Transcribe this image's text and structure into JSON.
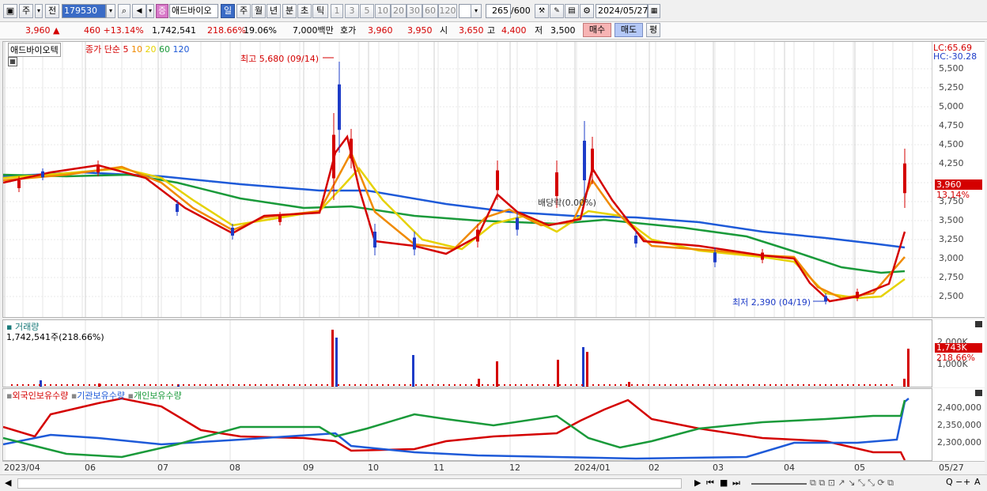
{
  "toolbar": {
    "period_jong": "주",
    "period_jeon": "전",
    "code": "179530",
    "badge": "증",
    "stock_name": "애드바이오",
    "tabs": [
      "일",
      "주",
      "월",
      "년",
      "분",
      "초",
      "틱"
    ],
    "intervals": [
      "1",
      "3",
      "5",
      "10",
      "20",
      "30",
      "60",
      "120"
    ],
    "count": "265",
    "count_total": "/600",
    "date": "2024/05/27"
  },
  "quote": {
    "price": "3,960 ▲",
    "change": "460 +13.14%",
    "volume": "1,742,541",
    "volume_ratio": "218.66%",
    "turnover": "19.06%",
    "amount": "7,000백만",
    "hoga_label": "호가",
    "ask": "3,960",
    "bid": "3,950",
    "open_label": "시",
    "open": "3,650",
    "high_label": "고",
    "high": "4,400",
    "low_label": "저",
    "low": "3,500",
    "buy_label": "매수",
    "sell_label": "매도",
    "eval_label": "평"
  },
  "price_panel": {
    "stock_tag": "애드바이오텍",
    "ma_label": "종가 단순",
    "ma_periods": [
      {
        "p": "5",
        "color": "#d40000"
      },
      {
        "p": "10",
        "color": "#f08a00"
      },
      {
        "p": "20",
        "color": "#e6d200"
      },
      {
        "p": "60",
        "color": "#1a9a3a"
      },
      {
        "p": "120",
        "color": "#1e5ad8"
      }
    ],
    "high_note": "최고 5,680 (09/14)",
    "low_note": "최저 2,390 (04/19)",
    "dividend_note": "배당락(0.00%)",
    "lc": "LC:65.69",
    "hc": "HC:-30.28",
    "current_price_tag": "3,960",
    "current_pct_tag": "13.14%",
    "y_ticks": [
      "5,500",
      "5,250",
      "5,000",
      "4,750",
      "4,500",
      "4,250",
      "3,750",
      "3,500",
      "3,250",
      "3,000",
      "2,750",
      "2,500"
    ]
  },
  "volume_panel": {
    "title": "거래량",
    "value": "1,742,541주(218.66%)",
    "y_ticks": [
      "2,000K",
      "1,000K"
    ],
    "current_tag": "1,743K",
    "current_pct": "218.66%"
  },
  "holding_panel": {
    "legends": [
      {
        "label": "외국인보유수량",
        "color": "#d40000"
      },
      {
        "label": "기관보유수량",
        "color": "#1e5ad8"
      },
      {
        "label": "개인보유수량",
        "color": "#1a9a3a"
      }
    ],
    "y_ticks": [
      "2,400,000",
      "2,350,000",
      "2,300,000"
    ]
  },
  "x_labels": [
    "2023/04",
    "06",
    "07",
    "08",
    "09",
    "10",
    "11",
    "12",
    "2024/01",
    "02",
    "03",
    "04",
    "05",
    "05/27"
  ],
  "colors": {
    "up": "#d40000",
    "down": "#1e3cc8",
    "accent": "#3a6bc6"
  }
}
